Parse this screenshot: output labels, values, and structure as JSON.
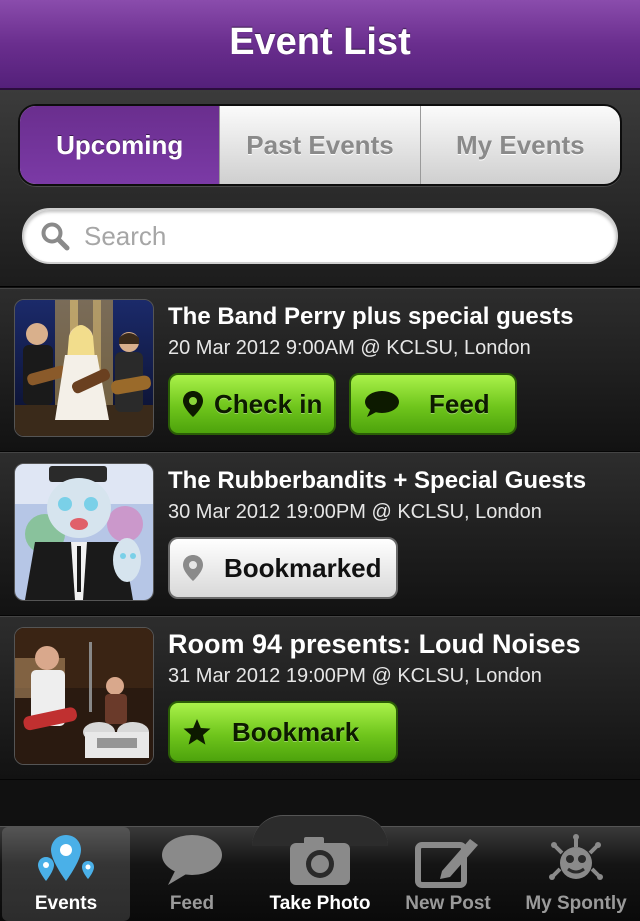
{
  "header": {
    "title": "Event List"
  },
  "tabs": {
    "items": [
      {
        "label": "Upcoming",
        "active": true
      },
      {
        "label": "Past Events",
        "active": false
      },
      {
        "label": "My Events",
        "active": false
      }
    ]
  },
  "search": {
    "placeholder": "Search",
    "value": ""
  },
  "events": [
    {
      "name": "The Band Perry plus special guests",
      "when": "20 Mar 2012 9:00AM @ KCLSU, London",
      "buttons": [
        "Check in",
        "Feed"
      ]
    },
    {
      "name": "The Rubberbandits + Special Guests",
      "when": "30 Mar 2012 19:00PM @ KCLSU, London",
      "buttons": [
        "Bookmarked"
      ]
    },
    {
      "name": "Room 94 presents: Loud Noises",
      "when": "31 Mar 2012 19:00PM @ KCLSU, London",
      "buttons": [
        "Bookmark"
      ]
    }
  ],
  "tabbar": {
    "items": [
      {
        "label": "Events",
        "icon": "map-pins-icon",
        "active": true
      },
      {
        "label": "Feed",
        "icon": "speech-bubble-icon",
        "active": false
      },
      {
        "label": "Take Photo",
        "icon": "camera-icon",
        "active": false
      },
      {
        "label": "New Post",
        "icon": "pencil-icon",
        "active": false
      },
      {
        "label": "My Spontly",
        "icon": "spontly-logo-icon",
        "active": false
      }
    ]
  },
  "colors": {
    "accent_purple": "#6a2e8e",
    "button_green": "#6fc51c"
  }
}
